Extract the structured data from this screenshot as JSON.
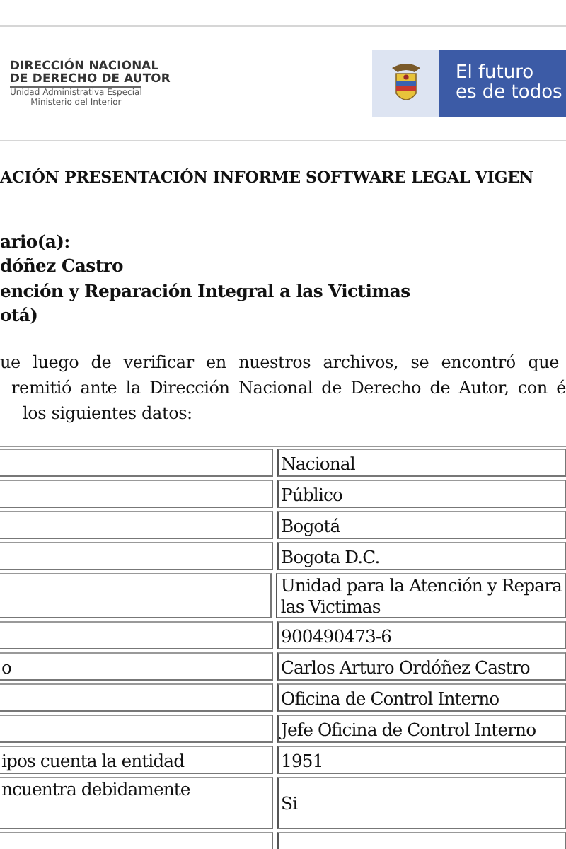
{
  "header": {
    "agency_logo": {
      "lines": [
        "DIRECCIÓN NACIONAL",
        "DE DERECHO DE AUTOR"
      ],
      "sublines": [
        "Unidad Administrativa Especial",
        "Ministerio del Interior"
      ]
    },
    "government_logo": {
      "slogan_lines": [
        "El futuro",
        "es de todos"
      ]
    }
  },
  "title": "ACIÓN PRESENTACIÓN INFORME SOFTWARE LEGAL VIGEN",
  "addressee_lines": [
    "ario(a):",
    "dóñez Castro",
    "ención y Reparación Integral a las Victimas",
    "otá)"
  ],
  "body_lines": [
    "ue luego de verificar en nuestros archivos, se encontró que",
    "remitió ante la Dirección Nacional de Derecho de Autor, con é",
    "los siguientes datos:"
  ],
  "table": {
    "rows": [
      {
        "value_lines": [
          "Nacional"
        ]
      },
      {
        "value_lines": [
          "Público"
        ]
      },
      {
        "value_lines": [
          "Bogotá"
        ]
      },
      {
        "value_lines": [
          "Bogota D.C."
        ]
      },
      {
        "value_lines": [
          "Unidad para la Atención y Repara",
          "las Victimas"
        ]
      },
      {
        "value_lines": [
          "900490473-6"
        ]
      },
      {
        "label_lines": [
          "o"
        ],
        "value_lines": [
          "Carlos Arturo Ordóñez Castro"
        ]
      },
      {
        "value_lines": [
          "Oficina de Control Interno"
        ]
      },
      {
        "value_lines": [
          "Jefe Oficina de Control Interno"
        ]
      },
      {
        "label_lines": [
          "ipos cuenta la entidad"
        ],
        "value_lines": [
          "1951"
        ]
      },
      {
        "label_lines": [
          "ncuentra debidamente"
        ],
        "value_lines": [
          "Si"
        ],
        "tall": true
      }
    ]
  }
}
